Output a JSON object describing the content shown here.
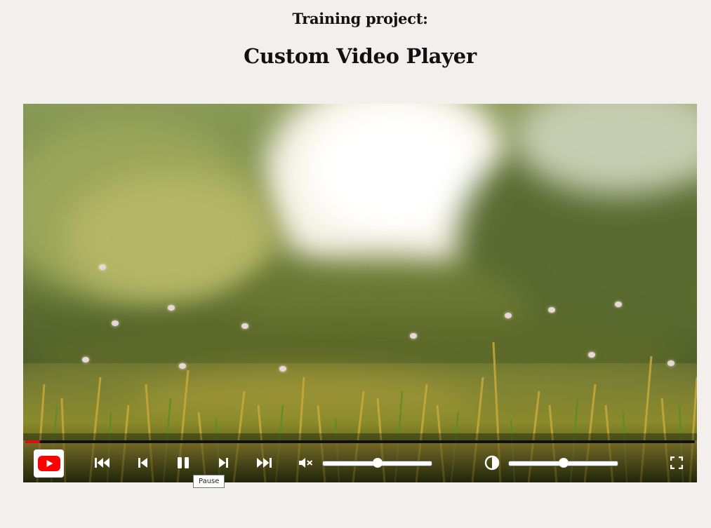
{
  "header": {
    "subtitle": "Training project:",
    "title": "Custom Video Player"
  },
  "player": {
    "progress_fraction": 0.022,
    "controls": {
      "logo_icon": "youtube-logo-icon",
      "buttons": [
        {
          "name": "skip-to-start-button",
          "icon": "skip-back-double-icon"
        },
        {
          "name": "previous-button",
          "icon": "skip-back-icon"
        },
        {
          "name": "pause-button",
          "icon": "pause-icon"
        },
        {
          "name": "next-button",
          "icon": "skip-forward-icon"
        },
        {
          "name": "skip-to-end-button",
          "icon": "skip-forward-double-icon"
        },
        {
          "name": "mute-button",
          "icon": "volume-muted-icon"
        },
        {
          "name": "brightness-button",
          "icon": "contrast-icon"
        },
        {
          "name": "fullscreen-button",
          "icon": "fullscreen-icon"
        }
      ],
      "volume_fraction": 0.5,
      "brightness_fraction": 0.5
    },
    "tooltip": "Pause"
  },
  "colors": {
    "background": "#f3efec",
    "progress": "#e10e0e",
    "youtube_red": "#ff0000"
  }
}
